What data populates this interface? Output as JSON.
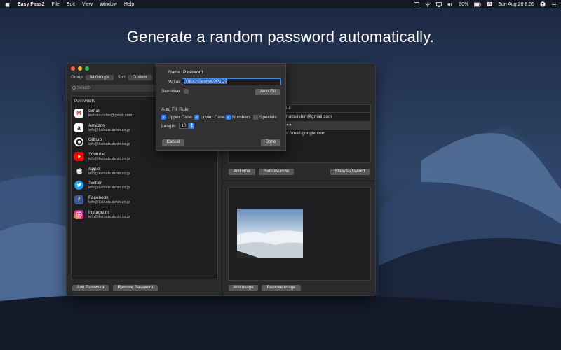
{
  "menubar": {
    "app_name": "Easy Pass2",
    "menus": [
      "File",
      "Edit",
      "View",
      "Window",
      "Help"
    ],
    "battery": "90%",
    "input_source": "A",
    "datetime": "Sun Aug 26  8:55"
  },
  "headline": "Generate a random password automatically.",
  "toolbar": {
    "group_label": "Group",
    "group_value": "All Groups",
    "sort_label": "Sort",
    "sort_value": "Custom",
    "search_placeholder": "Search"
  },
  "passwords": {
    "header": "Passwords",
    "items": [
      {
        "name": "Gmail",
        "account": "kaihatsuishin@gmail.com",
        "icon": "gmail-icon"
      },
      {
        "name": "Amazon",
        "account": "info@kaihatsuishin.co.jp",
        "icon": "amazon-icon"
      },
      {
        "name": "Github",
        "account": "info@kaihatsuishin.co.jp",
        "icon": "github-icon"
      },
      {
        "name": "Youtube",
        "account": "info@kaihatsuishin.co.jp",
        "icon": "youtube-icon"
      },
      {
        "name": "Apple",
        "account": "info@kaihatsuishin.co.jp",
        "icon": "apple-icon"
      },
      {
        "name": "Twitter",
        "account": "info@kaihatsuishin.co.jp",
        "icon": "twitter-icon"
      },
      {
        "name": "Facebook",
        "account": "info@kaihatsuishin.co.jp",
        "icon": "facebook-icon"
      },
      {
        "name": "Instagram",
        "account": "info@kaihatsuishin.co.jp",
        "icon": "instagram-icon"
      }
    ],
    "add_button": "Add Password",
    "remove_button": "Remove Password"
  },
  "fields": {
    "header": "ue",
    "rows": [
      "hatsuishin@gmail.com",
      "●●",
      "s://mail.google.com"
    ],
    "add_row": "Add Row",
    "remove_row": "Remove Row",
    "show_password": "Show Password"
  },
  "images": {
    "add_image": "Add Image",
    "remove_image": "Remove Image"
  },
  "sheet": {
    "name_label": "Name",
    "name_value": "Password",
    "value_label": "Value",
    "value_value": "tYiIkichSewwK0PzQ7",
    "sensitive_label": "Sensitive",
    "auto_fill_button": "Auto Fill",
    "rule_title": "Auto Fill Rule",
    "upper_case": "Upper Case",
    "lower_case": "Lower Case",
    "numbers": "Numbers",
    "specials": "Specials",
    "length_label": "Length",
    "length_value": "10",
    "cancel_button": "Cancel",
    "done_button": "Done"
  },
  "colors": {
    "accent": "#2f7ff5",
    "window_bg": "#2a2a2c",
    "list_bg": "#1e1e20"
  }
}
